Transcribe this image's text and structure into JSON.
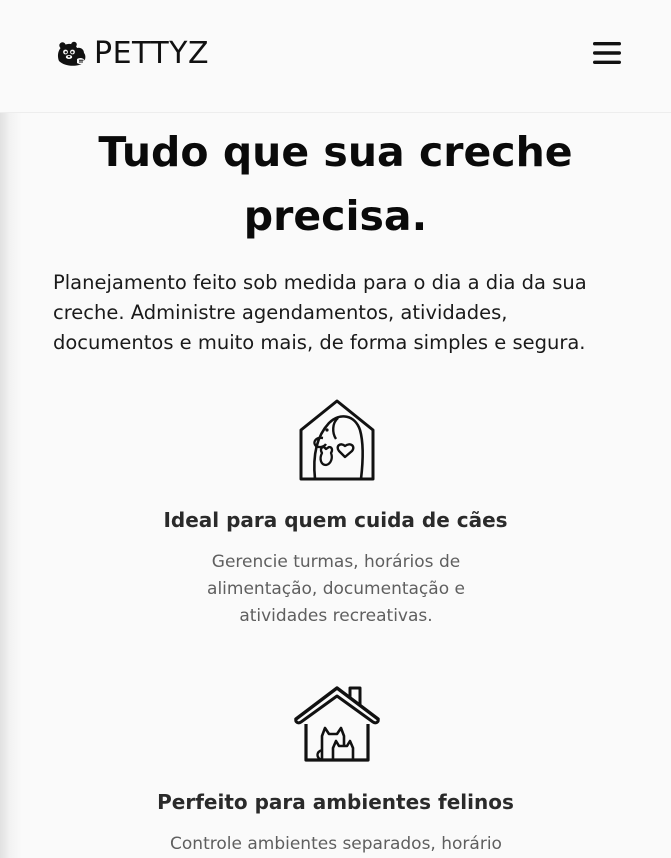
{
  "header": {
    "logo_text": "PETTYZ",
    "logo_icon": "otter-logo-icon",
    "menu_icon": "hamburger-menu-icon"
  },
  "hero": {
    "title": "Tudo que sua creche precisa.",
    "description": "Planejamento feito sob medida para o dia a dia da sua creche. Administre agendamentos, atividades, documentos e muito mais, de forma simples e segura."
  },
  "features": [
    {
      "icon": "dog-cat-heart-house-icon",
      "title": "Ideal para quem cuida de cães",
      "description": "Gerencie turmas, horários de alimentação, documentação e atividades recreativas."
    },
    {
      "icon": "cats-house-icon",
      "title": "Perfeito para ambientes felinos",
      "description": "Controle ambientes separados, horário"
    }
  ],
  "colors": {
    "background": "#fafafa",
    "text_primary": "#0a0a0a",
    "text_muted": "#5f5f5f",
    "icon_stroke": "#111111"
  }
}
